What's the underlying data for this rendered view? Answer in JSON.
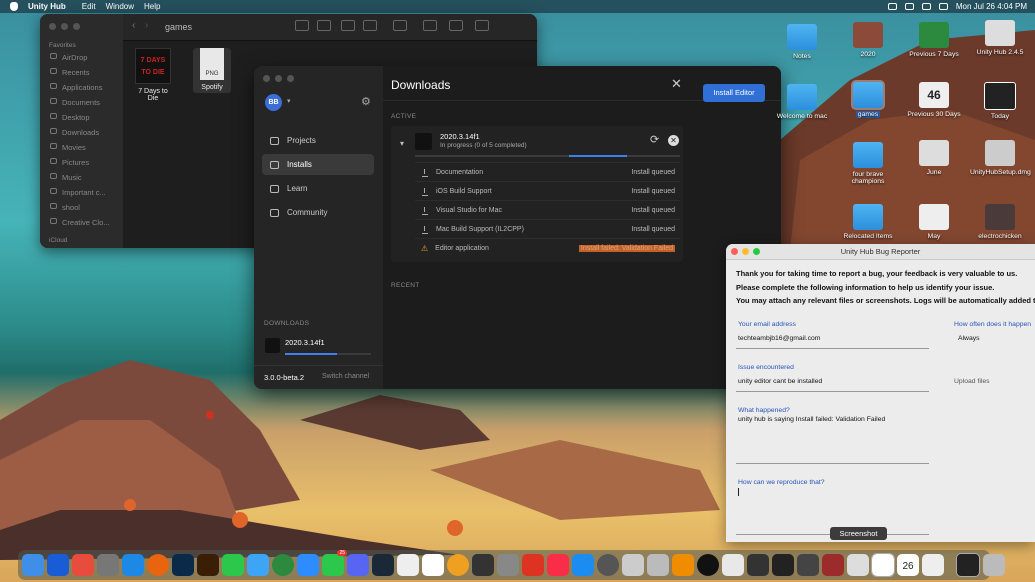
{
  "menubar": {
    "app": "Unity Hub",
    "items": [
      "Edit",
      "Window",
      "Help"
    ],
    "clock": "Mon Jul 26  4:04 PM"
  },
  "finder": {
    "title": "games",
    "sidebar_header": "Favorites",
    "sidebar_items": [
      "AirDrop",
      "Recents",
      "Applications",
      "Documents",
      "Desktop",
      "Downloads",
      "Movies",
      "Pictures",
      "Music",
      "Important c...",
      "shool",
      "Creative Clo..."
    ],
    "sidebar_footer": "iCloud",
    "files": [
      {
        "name": "7 Days to Die",
        "thumb": "7 DAYS TO DIE"
      },
      {
        "name": "Spotify",
        "thumb": "PNG"
      }
    ]
  },
  "hub": {
    "avatar": "BB",
    "nav": [
      "Projects",
      "Installs",
      "Learn",
      "Community"
    ],
    "downloads_label": "DOWNLOADS",
    "download_item": "2020.3.14f1",
    "download_progress": 0.6,
    "version": "3.0.0-beta.2",
    "switch_channel": "Switch channel",
    "panel_title": "Downloads",
    "install_editor": "Install Editor",
    "active_label": "ACTIVE",
    "recent_label": "RECENT",
    "editor_version": "2020.3.14f1",
    "editor_status": "In progress (0 of 5 completed)",
    "editor_progress": 0.22,
    "modules": [
      {
        "name": "Documentation",
        "status": "Install queued"
      },
      {
        "name": "iOS Build Support",
        "status": "Install queued"
      },
      {
        "name": "Visual Studio for Mac",
        "status": "Install queued"
      },
      {
        "name": "Mac Build Support (IL2CPP)",
        "status": "Install queued"
      },
      {
        "name": "Editor application",
        "status": "Install failed: Validation Failed"
      }
    ]
  },
  "bug": {
    "title": "Unity Hub Bug Reporter",
    "intro": [
      "Thank you for taking time to report a bug, your feedback is very valuable to us.",
      "Please complete the following information to help us identify your issue.",
      "You may attach any relevant files or screenshots. Logs will be automatically added to the"
    ],
    "email_label": "Your email address",
    "email_value": "techteambjb16@gmail.com",
    "freq_label": "How often does it happen",
    "freq_value": "Always",
    "issue_label": "Issue encountered",
    "issue_value": "unity editor cant be installed",
    "upload": "Upload files",
    "what_label": "What happened?",
    "what_value": "unity hub is saying Install failed: Validation Failed",
    "repro_label": "How can we reproduce that?",
    "tooltip": "Screenshot"
  },
  "desktop_icons": [
    {
      "label": "Notes"
    },
    {
      "label": "2020"
    },
    {
      "label": "Previous 7 Days"
    },
    {
      "label": "Unity Hub 2.4.5"
    },
    {
      "label": "Welcome to mac"
    },
    {
      "label": "games"
    },
    {
      "label": "Previous 30 Days"
    },
    {
      "label": "Today"
    },
    {
      "label": "four brave champions"
    },
    {
      "label": "June"
    },
    {
      "label": "UnityHubSetup.dmg"
    },
    {
      "label": "Relocated Items"
    },
    {
      "label": "May"
    },
    {
      "label": "electrochicken"
    }
  ],
  "calendar_day": "46",
  "dock_date": "26",
  "dock_badge": "25"
}
